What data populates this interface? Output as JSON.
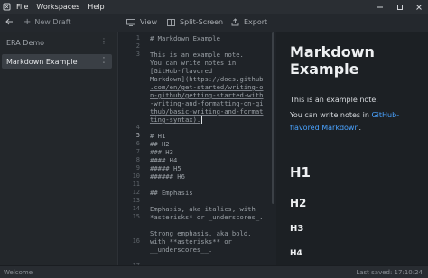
{
  "menubar": {
    "items": [
      "File",
      "Workspaces",
      "Help"
    ],
    "window_controls": [
      "minimize-icon",
      "maximize-icon",
      "close-icon"
    ]
  },
  "toolbar": {
    "new_draft_label": "New Draft",
    "view_label": "View",
    "split_screen_label": "Split-Screen",
    "export_label": "Export"
  },
  "sidebar": {
    "items": [
      {
        "label": "ERA Demo",
        "active": false
      },
      {
        "label": "Markdown Example",
        "active": true
      }
    ]
  },
  "editor": {
    "line_numbers": [
      "1",
      "2",
      "3",
      "",
      "",
      "",
      "",
      "",
      "",
      "4",
      "5",
      "6",
      "7",
      "8",
      "9",
      "10",
      "11",
      "12",
      "13",
      "14",
      "15",
      "16",
      "17",
      "18"
    ],
    "lines": [
      "# Markdown Example",
      "",
      "This is an example note.",
      "You can write notes in",
      "[GitHub-flavored",
      "Markdown](https://docs.github",
      ".com/en/get-started/writing-o",
      "n-github/getting-started-with",
      "-writing-and-formatting-on-gi",
      "thub/basic-writing-and-format",
      "ting-syntax).",
      "",
      "# H1",
      "## H2",
      "### H3",
      "#### H4",
      "##### H5",
      "###### H6",
      "",
      "## Emphasis",
      "",
      "Emphasis, aka italics, with",
      "*asterisks* or _underscores_.",
      "",
      "Strong emphasis, aka bold,",
      "with **asterisks** or",
      "__underscores__."
    ]
  },
  "preview": {
    "title": "Markdown Example",
    "para1": "This is an example note.",
    "para2_prefix": "You can write notes in",
    "para2_link_a": "GitHub-",
    "para2_link_b": "flavored Markdown",
    "para2_suffix": ".",
    "h1": "H1",
    "h2": "H2",
    "h3": "H3",
    "h4": "H4"
  },
  "statusbar": {
    "left": "Welcome",
    "right": "Last saved: 17:10:24"
  },
  "colors": {
    "accent_link": "#4aa3ff",
    "active_item": "#3a3f45"
  }
}
